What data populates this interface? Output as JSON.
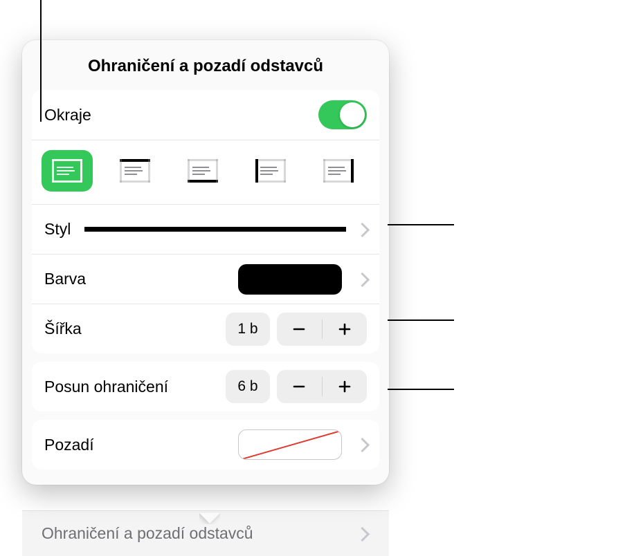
{
  "title": "Ohraničení a pozadí odstavců",
  "borders": {
    "toggle_label": "Okraje",
    "toggle_on": true
  },
  "style": {
    "label": "Styl"
  },
  "color": {
    "label": "Barva",
    "value": "#000000"
  },
  "width": {
    "label": "Šířka",
    "value": "1 b"
  },
  "offset": {
    "label": "Posun ohraničení",
    "value": "6 b"
  },
  "background": {
    "label": "Pozadí"
  },
  "under_menu": {
    "label": "Ohraničení a pozadí odstavců"
  }
}
